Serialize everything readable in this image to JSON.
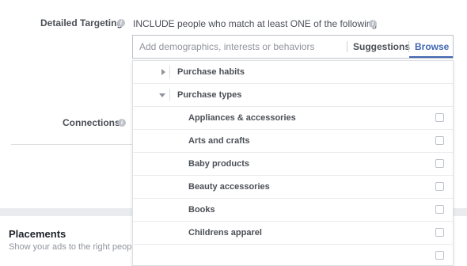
{
  "targeting": {
    "label": "Detailed Targeting",
    "include_text": "INCLUDE people who match at least ONE of the following",
    "search_placeholder": "Add demographics, interests or behaviors",
    "suggestions_label": "Suggestions",
    "browse_label": "Browse"
  },
  "connections": {
    "label": "Connections"
  },
  "placements": {
    "title": "Placements",
    "subtitle": "Show your ads to the right people"
  },
  "dropdown": {
    "categories": [
      {
        "label": "Purchase habits",
        "expanded": false
      },
      {
        "label": "Purchase types",
        "expanded": true
      }
    ],
    "items": [
      {
        "label": "Appliances & accessories",
        "checked": false
      },
      {
        "label": "Arts and crafts",
        "checked": false
      },
      {
        "label": "Baby products",
        "checked": false
      },
      {
        "label": "Beauty accessories",
        "checked": false
      },
      {
        "label": "Books",
        "checked": false
      },
      {
        "label": "Childrens apparel",
        "checked": false
      }
    ]
  },
  "colors": {
    "accent": "#4267b2",
    "text": "#4b4f56",
    "muted": "#90949c"
  },
  "icons": {
    "info": "info-icon",
    "collapsed": "caret-right-icon",
    "expanded": "caret-down-icon"
  }
}
